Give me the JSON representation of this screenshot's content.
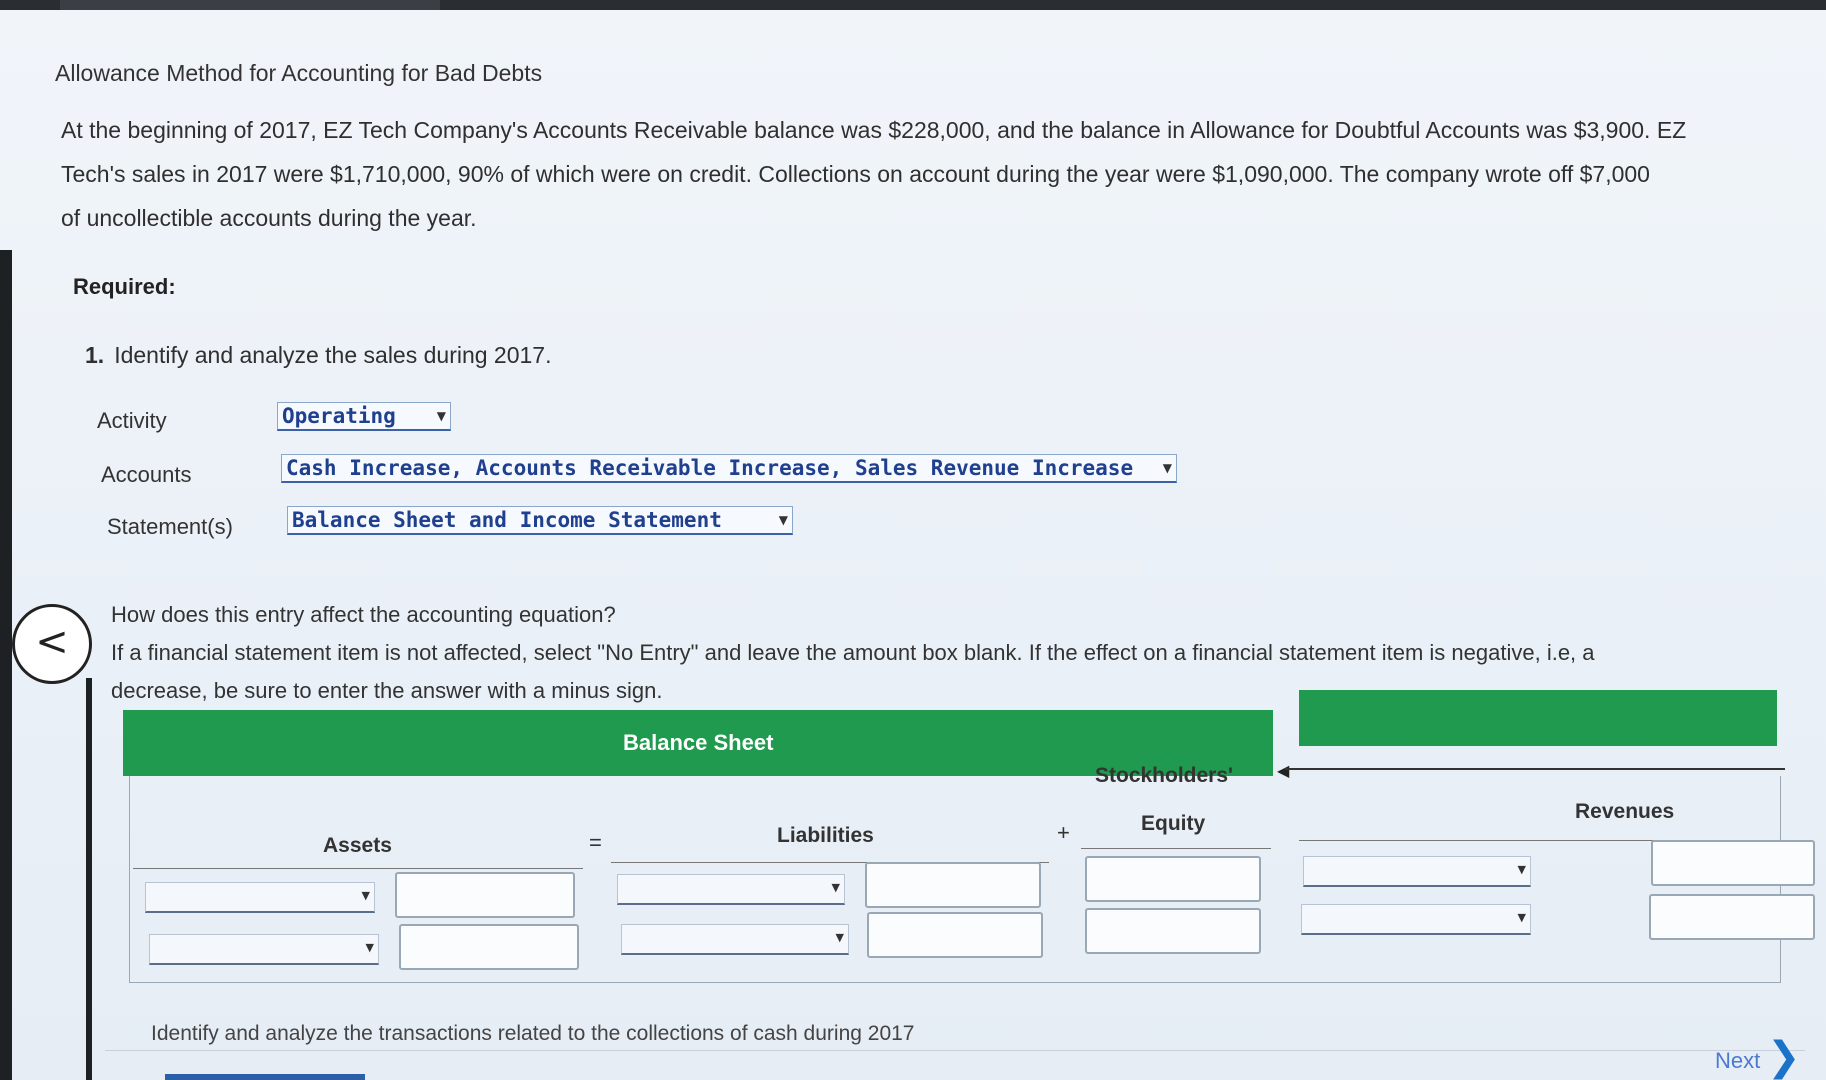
{
  "problem": {
    "title": "Allowance Method for Accounting for Bad Debts",
    "line1": "At the beginning of 2017, EZ Tech Company's Accounts Receivable balance was $228,000, and the balance in Allowance for Doubtful Accounts was $3,900. EZ",
    "line2": "Tech's sales in 2017 were $1,710,000, 90% of which were on credit. Collections on account during the year were $1,090,000. The company wrote off $7,000",
    "line3": "of uncollectible accounts during the year.",
    "required_label": "Required:"
  },
  "question1": {
    "number": "1.",
    "text": "Identify and analyze the sales during 2017.",
    "activity_label": "Activity",
    "activity_value": "Operating",
    "accounts_label": "Accounts",
    "accounts_value": "Cash Increase, Accounts Receivable Increase, Sales Revenue Increase",
    "statements_label": "Statement(s)",
    "statements_value": "Balance Sheet and Income Statement"
  },
  "instructions": {
    "line1": "How does this entry affect the accounting equation?",
    "line2": "If a financial statement item is not affected, select \"No Entry\" and leave the amount box blank. If the effect on a financial statement item is negative, i.e, a",
    "line3": "decrease, be sure to enter the answer with a minus sign."
  },
  "table": {
    "balance_sheet_header": "Balance Sheet",
    "assets": "Assets",
    "equals": "=",
    "liabilities": "Liabilities",
    "plus": "+",
    "stockholders": "Stockholders'",
    "equity": "Equity",
    "revenues": "Revenues"
  },
  "footer": {
    "next_question": "Identify and analyze the transactions related to the collections of cash during 2017",
    "next_label": "Next"
  },
  "icons": {
    "back": "chevron-left-icon",
    "next": "chevron-right-icon",
    "dropdown": "caret-down-icon"
  },
  "colors": {
    "header_green": "#1f9a4e",
    "select_text": "#1f3f8f",
    "next_blue": "#1a73c9"
  }
}
